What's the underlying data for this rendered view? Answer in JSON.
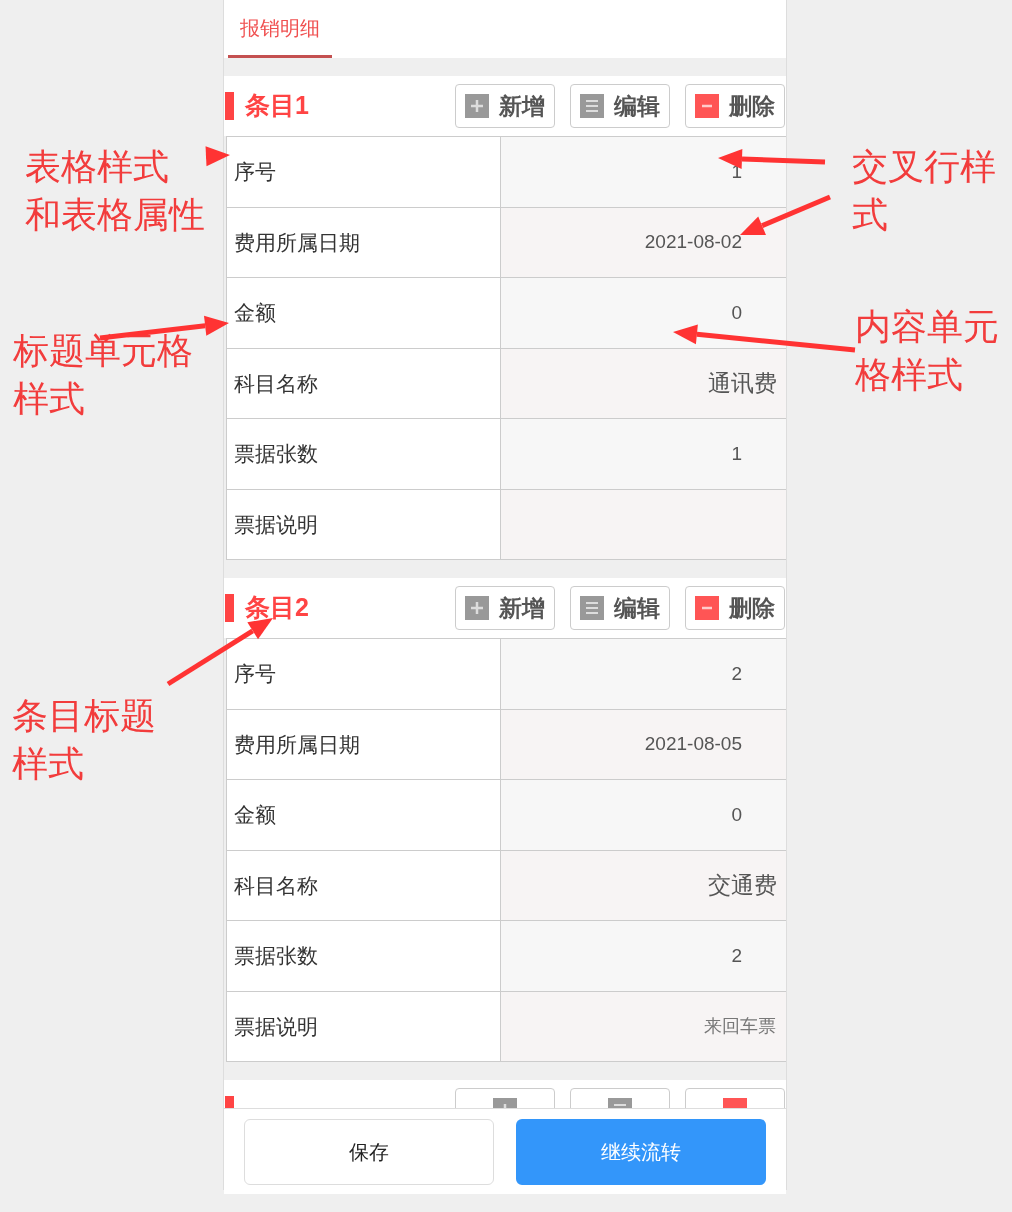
{
  "tab": {
    "label": "报销明细",
    "selected": true
  },
  "items": [
    {
      "title": "条目1",
      "actions": [
        {
          "label": "新增",
          "kind": "add"
        },
        {
          "label": "编辑",
          "kind": "edit"
        },
        {
          "label": "删除",
          "kind": "delete"
        }
      ],
      "fields": [
        {
          "label": "序号",
          "value": "1",
          "kind": "input"
        },
        {
          "label": "费用所属日期",
          "value": "2021-08-02",
          "kind": "input"
        },
        {
          "label": "金额",
          "value": "0",
          "kind": "input"
        },
        {
          "label": "科目名称",
          "value": "通讯费",
          "kind": "select"
        },
        {
          "label": "票据张数",
          "value": "1",
          "kind": "input"
        },
        {
          "label": "票据说明",
          "kind": "note"
        }
      ]
    },
    {
      "title": "条目2",
      "actions": [
        {
          "label": "新增",
          "kind": "add"
        },
        {
          "label": "编辑",
          "kind": "edit"
        },
        {
          "label": "删除",
          "kind": "delete"
        }
      ],
      "fields": [
        {
          "label": "序号",
          "value": "2",
          "kind": "input"
        },
        {
          "label": "费用所属日期",
          "value": "2021-08-05",
          "kind": "input"
        },
        {
          "label": "金额",
          "value": "0",
          "kind": "input"
        },
        {
          "label": "科目名称",
          "value": "交通费",
          "kind": "select"
        },
        {
          "label": "票据张数",
          "value": "2",
          "kind": "input"
        },
        {
          "label": "票据说明",
          "value": "来回车票",
          "kind": "note"
        }
      ]
    },
    {
      "actions": [
        {
          "kind": "add"
        },
        {
          "kind": "edit"
        },
        {
          "kind": "delete"
        }
      ]
    }
  ],
  "footer": {
    "buttons": [
      {
        "label": "保存",
        "kind": "secondary"
      },
      {
        "label": "继续流转",
        "kind": "primary"
      }
    ]
  },
  "annotations": [
    {
      "lines": [
        "表格样式",
        "和表格属性"
      ]
    },
    {
      "lines": [
        "交叉行样",
        "式"
      ]
    },
    {
      "lines": [
        "内容单元",
        "格样式"
      ]
    },
    {
      "lines": [
        "标题单元格",
        "样式"
      ]
    },
    {
      "lines": [
        "条目标题",
        "样式"
      ]
    }
  ]
}
